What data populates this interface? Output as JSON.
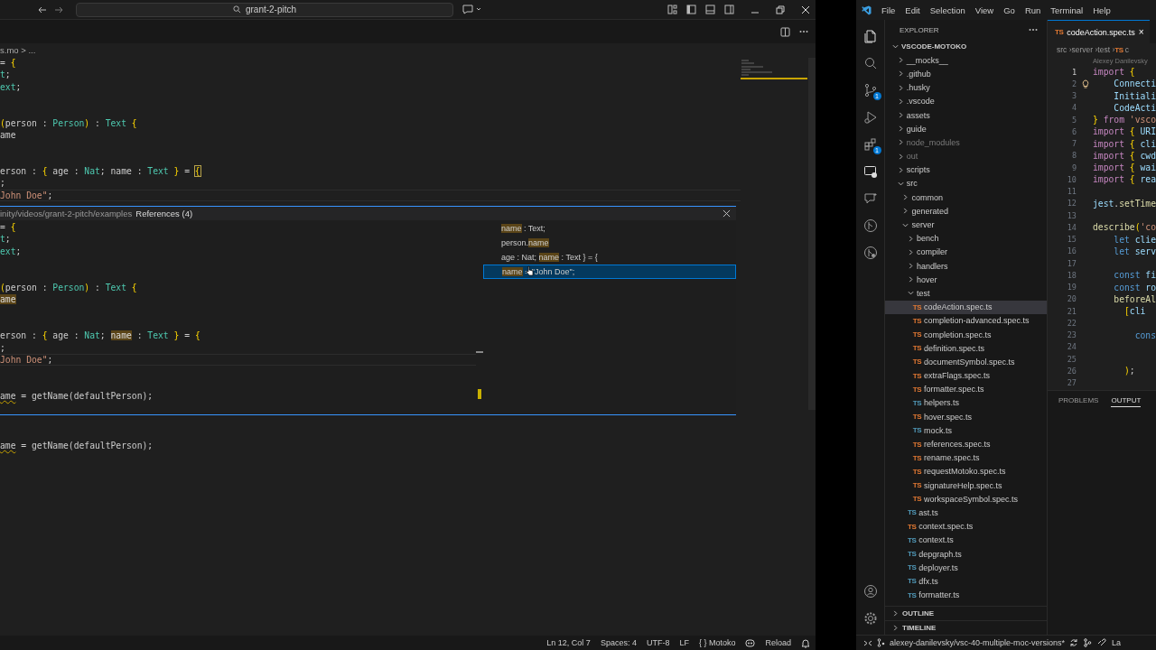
{
  "left_window": {
    "search": "grant-2-pitch",
    "breadcrumb": "s.mo > ...",
    "editor_lines": [
      {
        "current": false,
        "tokens": [
          {
            "text": "= ",
            "kind": "plain"
          },
          {
            "text": "{",
            "kind": "brace"
          }
        ]
      },
      {
        "current": false,
        "tokens": [
          {
            "text": "t",
            "kind": "type"
          },
          {
            "text": ";",
            "kind": "plain"
          }
        ]
      },
      {
        "current": false,
        "tokens": [
          {
            "text": "ext",
            "kind": "type"
          },
          {
            "text": ";",
            "kind": "plain"
          }
        ]
      },
      {
        "kind": "blank"
      },
      {
        "kind": "blank"
      },
      {
        "current": false,
        "tokens": [
          {
            "text": "(",
            "kind": "brace"
          },
          {
            "text": "person : ",
            "kind": "plain"
          },
          {
            "text": "Person",
            "kind": "type"
          },
          {
            "text": ")",
            "kind": "brace"
          },
          {
            "text": " : ",
            "kind": "plain"
          },
          {
            "text": "Text",
            "kind": "type"
          },
          {
            "text": " {",
            "kind": "brace"
          }
        ]
      },
      {
        "current": false,
        "tokens": [
          {
            "text": "ame",
            "kind": "plain"
          }
        ]
      },
      {
        "kind": "blank"
      },
      {
        "kind": "blank"
      },
      {
        "current": false,
        "tokens": [
          {
            "text": "erson : ",
            "kind": "plain"
          },
          {
            "text": "{",
            "kind": "brace"
          },
          {
            "text": " age : ",
            "kind": "plain"
          },
          {
            "text": "Nat",
            "kind": "type"
          },
          {
            "text": "; name : ",
            "kind": "plain"
          },
          {
            "text": "Text",
            "kind": "type"
          },
          {
            "text": " }",
            "kind": "brace"
          },
          {
            "text": " = ",
            "kind": "plain"
          },
          {
            "text": "{",
            "kind": "match"
          }
        ]
      },
      {
        "current": false,
        "tokens": [
          {
            "text": ";",
            "kind": "plain"
          }
        ]
      },
      {
        "current": true,
        "tokens": [
          {
            "text": "John Doe\"",
            "kind": "string"
          },
          {
            "text": ";",
            "kind": "plain"
          }
        ]
      }
    ],
    "peek": {
      "path": "inity/videos/grant-2-pitch/examples",
      "title": "References (4)",
      "lines": [
        {
          "current": false,
          "tokens": [
            {
              "text": "= ",
              "kind": "plain"
            },
            {
              "text": "{",
              "kind": "brace"
            }
          ]
        },
        {
          "current": false,
          "tokens": [
            {
              "text": "t",
              "kind": "type"
            },
            {
              "text": ";",
              "kind": "plain"
            }
          ]
        },
        {
          "current": false,
          "tokens": [
            {
              "text": "ext",
              "kind": "type"
            },
            {
              "text": ";",
              "kind": "plain"
            }
          ]
        },
        {
          "kind": "blank"
        },
        {
          "kind": "blank"
        },
        {
          "current": false,
          "tokens": [
            {
              "text": "(",
              "kind": "brace"
            },
            {
              "text": "person : ",
              "kind": "plain"
            },
            {
              "text": "Person",
              "kind": "type"
            },
            {
              "text": ")",
              "kind": "brace"
            },
            {
              "text": " : ",
              "kind": "plain"
            },
            {
              "text": "Text",
              "kind": "type"
            },
            {
              "text": " {",
              "kind": "brace"
            }
          ]
        },
        {
          "current": false,
          "tokens": [
            {
              "text": "ame",
              "kind": "ref"
            }
          ]
        },
        {
          "kind": "blank"
        },
        {
          "kind": "blank"
        },
        {
          "current": false,
          "tokens": [
            {
              "text": "erson : ",
              "kind": "plain"
            },
            {
              "text": "{",
              "kind": "brace"
            },
            {
              "text": " age : ",
              "kind": "plain"
            },
            {
              "text": "Nat",
              "kind": "type"
            },
            {
              "text": "; ",
              "kind": "plain"
            },
            {
              "text": "name",
              "kind": "ref"
            },
            {
              "text": " : ",
              "kind": "plain"
            },
            {
              "text": "Text",
              "kind": "type"
            },
            {
              "text": " }",
              "kind": "brace"
            },
            {
              "text": " = ",
              "kind": "plain"
            },
            {
              "text": "{",
              "kind": "brace"
            }
          ]
        },
        {
          "current": false,
          "tokens": [
            {
              "text": ";",
              "kind": "plain"
            }
          ]
        },
        {
          "current": true,
          "tokens": [
            {
              "text": "John Doe\"",
              "kind": "string"
            },
            {
              "text": ";",
              "kind": "plain"
            }
          ]
        },
        {
          "kind": "blank"
        },
        {
          "kind": "blank"
        },
        {
          "current": false,
          "tokens": [
            {
              "text": "ame",
              "kind": "warn"
            },
            {
              "text": " = getName(defaultPerson);",
              "kind": "plain"
            }
          ]
        }
      ],
      "references": [
        {
          "selected": false,
          "tokens": [
            {
              "text": "name",
              "kind": "ref"
            },
            {
              "text": " : Text;",
              "kind": "plain"
            }
          ]
        },
        {
          "selected": false,
          "tokens": [
            {
              "text": "person.",
              "kind": "plain"
            },
            {
              "text": "name",
              "kind": "ref"
            }
          ]
        },
        {
          "selected": false,
          "tokens": [
            {
              "text": "age : Nat; ",
              "kind": "plain"
            },
            {
              "text": "name",
              "kind": "ref"
            },
            {
              "text": " : Text } = {",
              "kind": "plain"
            }
          ]
        },
        {
          "selected": true,
          "tokens": [
            {
              "text": "name",
              "kind": "ref"
            },
            {
              "text": " = \"John Doe\";",
              "kind": "plain"
            }
          ]
        }
      ]
    },
    "lines_below": [
      {
        "kind": "blank"
      },
      {
        "kind": "blank"
      },
      {
        "current": false,
        "tokens": [
          {
            "text": "ame",
            "kind": "warn"
          },
          {
            "text": " = getName(defaultPerson);",
            "kind": "plain"
          }
        ]
      }
    ],
    "status_bar": [
      "Ln 12, Col 7",
      "Spaces: 4",
      "UTF-8",
      "LF",
      "{ } Motoko",
      "Reload"
    ]
  },
  "right_window": {
    "menu": [
      "File",
      "Edit",
      "Selection",
      "View",
      "Go",
      "Run",
      "Terminal",
      "Help"
    ],
    "activity_badges": [
      "1",
      "1"
    ],
    "explorer": {
      "title": "EXPLORER",
      "tree": [
        {
          "label": "VSCODE-MOTOKO",
          "kind": "folder",
          "expanded": true,
          "selected": false,
          "children": [
            {
              "label": "__mocks__",
              "kind": "folder",
              "expanded": false,
              "selected": false,
              "dimmed": false
            },
            {
              "label": ".github",
              "kind": "folder",
              "expanded": false,
              "selected": false,
              "dimmed": false
            },
            {
              "label": ".husky",
              "kind": "folder",
              "expanded": false,
              "selected": false,
              "dimmed": false
            },
            {
              "label": ".vscode",
              "kind": "folder",
              "expanded": false,
              "selected": false,
              "dimmed": false
            },
            {
              "label": "assets",
              "kind": "folder",
              "expanded": false,
              "selected": false,
              "dimmed": false
            },
            {
              "label": "guide",
              "kind": "folder",
              "expanded": false,
              "selected": false,
              "dimmed": false
            },
            {
              "label": "node_modules",
              "kind": "folder",
              "expanded": false,
              "selected": false,
              "dimmed": true
            },
            {
              "label": "out",
              "kind": "folder",
              "expanded": false,
              "selected": false,
              "dimmed": true
            },
            {
              "label": "scripts",
              "kind": "folder",
              "expanded": false,
              "selected": false,
              "dimmed": false
            },
            {
              "label": "src",
              "kind": "folder",
              "expanded": true,
              "selected": false,
              "dimmed": false,
              "children": [
                {
                  "label": "common",
                  "kind": "folder",
                  "expanded": false,
                  "selected": false,
                  "dimmed": false
                },
                {
                  "label": "generated",
                  "kind": "folder",
                  "expanded": false,
                  "selected": false,
                  "dimmed": false
                },
                {
                  "label": "server",
                  "kind": "folder",
                  "expanded": true,
                  "selected": false,
                  "dimmed": false,
                  "children": [
                    {
                      "label": "bench",
                      "kind": "folder",
                      "expanded": false,
                      "selected": false,
                      "dimmed": false
                    },
                    {
                      "label": "compiler",
                      "kind": "folder",
                      "expanded": false,
                      "selected": false,
                      "dimmed": false
                    },
                    {
                      "label": "handlers",
                      "kind": "folder",
                      "expanded": false,
                      "selected": false,
                      "dimmed": false
                    },
                    {
                      "label": "hover",
                      "kind": "folder",
                      "expanded": false,
                      "selected": false,
                      "dimmed": false
                    },
                    {
                      "label": "test",
                      "kind": "folder",
                      "expanded": true,
                      "selected": false,
                      "dimmed": false,
                      "children": [
                        {
                          "label": "codeAction.spec.ts",
                          "kind": "file",
                          "badge": "TS",
                          "color": "#e37933",
                          "selected": true,
                          "dimmed": false
                        },
                        {
                          "label": "completion-advanced.spec.ts",
                          "kind": "file",
                          "badge": "TS",
                          "color": "#e37933",
                          "selected": false,
                          "dimmed": false
                        },
                        {
                          "label": "completion.spec.ts",
                          "kind": "file",
                          "badge": "TS",
                          "color": "#e37933",
                          "selected": false,
                          "dimmed": false
                        },
                        {
                          "label": "definition.spec.ts",
                          "kind": "file",
                          "badge": "TS",
                          "color": "#e37933",
                          "selected": false,
                          "dimmed": false
                        },
                        {
                          "label": "documentSymbol.spec.ts",
                          "kind": "file",
                          "badge": "TS",
                          "color": "#e37933",
                          "selected": false,
                          "dimmed": false
                        },
                        {
                          "label": "extraFlags.spec.ts",
                          "kind": "file",
                          "badge": "TS",
                          "color": "#e37933",
                          "selected": false,
                          "dimmed": false
                        },
                        {
                          "label": "formatter.spec.ts",
                          "kind": "file",
                          "badge": "TS",
                          "color": "#e37933",
                          "selected": false,
                          "dimmed": false
                        },
                        {
                          "label": "helpers.ts",
                          "kind": "file",
                          "badge": "TS",
                          "color": "#519aba",
                          "selected": false,
                          "dimmed": false
                        },
                        {
                          "label": "hover.spec.ts",
                          "kind": "file",
                          "badge": "TS",
                          "color": "#e37933",
                          "selected": false,
                          "dimmed": false
                        },
                        {
                          "label": "mock.ts",
                          "kind": "file",
                          "badge": "TS",
                          "color": "#519aba",
                          "selected": false,
                          "dimmed": false
                        },
                        {
                          "label": "references.spec.ts",
                          "kind": "file",
                          "badge": "TS",
                          "color": "#e37933",
                          "selected": false,
                          "dimmed": false
                        },
                        {
                          "label": "rename.spec.ts",
                          "kind": "file",
                          "badge": "TS",
                          "color": "#e37933",
                          "selected": false,
                          "dimmed": false
                        },
                        {
                          "label": "requestMotoko.spec.ts",
                          "kind": "file",
                          "badge": "TS",
                          "color": "#e37933",
                          "selected": false,
                          "dimmed": false
                        },
                        {
                          "label": "signatureHelp.spec.ts",
                          "kind": "file",
                          "badge": "TS",
                          "color": "#e37933",
                          "selected": false,
                          "dimmed": false
                        },
                        {
                          "label": "workspaceSymbol.spec.ts",
                          "kind": "file",
                          "badge": "TS",
                          "color": "#e37933",
                          "selected": false,
                          "dimmed": false
                        }
                      ]
                    },
                    {
                      "label": "ast.ts",
                      "kind": "file",
                      "badge": "TS",
                      "color": "#519aba",
                      "selected": false,
                      "dimmed": false
                    },
                    {
                      "label": "context.spec.ts",
                      "kind": "file",
                      "badge": "TS",
                      "color": "#e37933",
                      "selected": false,
                      "dimmed": false
                    },
                    {
                      "label": "context.ts",
                      "kind": "file",
                      "badge": "TS",
                      "color": "#519aba",
                      "selected": false,
                      "dimmed": false
                    },
                    {
                      "label": "depgraph.ts",
                      "kind": "file",
                      "badge": "TS",
                      "color": "#519aba",
                      "selected": false,
                      "dimmed": false
                    },
                    {
                      "label": "deployer.ts",
                      "kind": "file",
                      "badge": "TS",
                      "color": "#519aba",
                      "selected": false,
                      "dimmed": false
                    },
                    {
                      "label": "dfx.ts",
                      "kind": "file",
                      "badge": "TS",
                      "color": "#519aba",
                      "selected": false,
                      "dimmed": false
                    },
                    {
                      "label": "formatter.ts",
                      "kind": "file",
                      "badge": "TS",
                      "color": "#519aba",
                      "selected": false,
                      "dimmed": false
                    }
                  ]
                }
              ]
            }
          ]
        }
      ],
      "sections": [
        "OUTLINE",
        "TIMELINE"
      ]
    },
    "tab": {
      "badge": "TS",
      "label": "codeAction.spec.ts",
      "close": "×"
    },
    "breadcrumb": {
      "parts": [
        "src",
        "server",
        "test"
      ],
      "separator": "›",
      "badge": "TS",
      "tail": "c"
    },
    "blame": "Alexey Danilevsky",
    "code": [
      {
        "number": "1",
        "current": true,
        "tokens": [
          {
            "text": "import",
            "kind": "keyword"
          },
          {
            "text": " {",
            "kind": "brace"
          }
        ]
      },
      {
        "number": "2",
        "current": false,
        "lightbulb": true,
        "tokens": [
          {
            "text": "    Connecti",
            "kind": "ident"
          }
        ]
      },
      {
        "number": "3",
        "current": false,
        "tokens": [
          {
            "text": "    Initiali",
            "kind": "ident"
          }
        ]
      },
      {
        "number": "4",
        "current": false,
        "tokens": [
          {
            "text": "    CodeActi",
            "kind": "ident"
          }
        ]
      },
      {
        "number": "5",
        "current": false,
        "tokens": [
          {
            "text": "}",
            "kind": "brace"
          },
          {
            "text": " from",
            "kind": "keyword"
          },
          {
            "text": " 'vsco",
            "kind": "string"
          }
        ]
      },
      {
        "number": "6",
        "current": false,
        "tokens": [
          {
            "text": "import",
            "kind": "keyword"
          },
          {
            "text": " {",
            "kind": "brace"
          },
          {
            "text": " URI",
            "kind": "ident"
          }
        ]
      },
      {
        "number": "7",
        "current": false,
        "tokens": [
          {
            "text": "import",
            "kind": "keyword"
          },
          {
            "text": " {",
            "kind": "brace"
          },
          {
            "text": " cli",
            "kind": "ident"
          }
        ]
      },
      {
        "number": "8",
        "current": false,
        "tokens": [
          {
            "text": "import",
            "kind": "keyword"
          },
          {
            "text": " {",
            "kind": "brace"
          },
          {
            "text": " cwd",
            "kind": "ident"
          }
        ]
      },
      {
        "number": "9",
        "current": false,
        "tokens": [
          {
            "text": "import",
            "kind": "keyword"
          },
          {
            "text": " {",
            "kind": "brace"
          },
          {
            "text": " wai",
            "kind": "ident"
          }
        ]
      },
      {
        "number": "10",
        "current": false,
        "tokens": [
          {
            "text": "import",
            "kind": "keyword"
          },
          {
            "text": " {",
            "kind": "brace"
          },
          {
            "text": " rea",
            "kind": "ident"
          }
        ]
      },
      {
        "number": "11",
        "current": false
      },
      {
        "number": "12",
        "current": false,
        "tokens": [
          {
            "text": "jest",
            "kind": "ident"
          },
          {
            "text": ".",
            "kind": "plain"
          },
          {
            "text": "setTime",
            "kind": "fn"
          }
        ]
      },
      {
        "number": "13",
        "current": false
      },
      {
        "number": "14",
        "current": false,
        "tokens": [
          {
            "text": "describe",
            "kind": "fn"
          },
          {
            "text": "(",
            "kind": "brace"
          },
          {
            "text": "'co",
            "kind": "string"
          }
        ]
      },
      {
        "number": "15",
        "current": false,
        "tokens": [
          {
            "text": "    let",
            "kind": "storage"
          },
          {
            "text": " clie",
            "kind": "ident"
          }
        ]
      },
      {
        "number": "16",
        "current": false,
        "tokens": [
          {
            "text": "    let",
            "kind": "storage"
          },
          {
            "text": " serv",
            "kind": "ident"
          }
        ]
      },
      {
        "number": "17",
        "current": false
      },
      {
        "number": "18",
        "current": false,
        "tokens": [
          {
            "text": "    const",
            "kind": "storage"
          },
          {
            "text": " fi",
            "kind": "ident"
          }
        ]
      },
      {
        "number": "19",
        "current": false,
        "tokens": [
          {
            "text": "    const",
            "kind": "storage"
          },
          {
            "text": " ro",
            "kind": "ident"
          }
        ]
      },
      {
        "number": "20",
        "current": false,
        "tokens": [
          {
            "text": "    beforeAl",
            "kind": "fn"
          }
        ]
      },
      {
        "number": "21",
        "current": false,
        "tokens": [
          {
            "text": "      [",
            "kind": "brace"
          },
          {
            "text": "cli",
            "kind": "ident"
          }
        ]
      },
      {
        "number": "22",
        "current": false
      },
      {
        "number": "23",
        "current": false,
        "tokens": [
          {
            "text": "        cons",
            "kind": "storage"
          }
        ]
      },
      {
        "number": "24",
        "current": false
      },
      {
        "number": "25",
        "current": false
      },
      {
        "number": "26",
        "current": false,
        "tokens": [
          {
            "text": "      )",
            "kind": "brace"
          },
          {
            "text": ";",
            "kind": "plain"
          }
        ]
      },
      {
        "number": "27",
        "current": false
      }
    ],
    "panel_tabs": [
      {
        "label": "PROBLEMS",
        "selected": false
      },
      {
        "label": "OUTPUT",
        "selected": true
      }
    ],
    "status_branch": "alexey-danilevsky/vsc-40-multiple-moc-versions*",
    "status_tail": "La"
  }
}
